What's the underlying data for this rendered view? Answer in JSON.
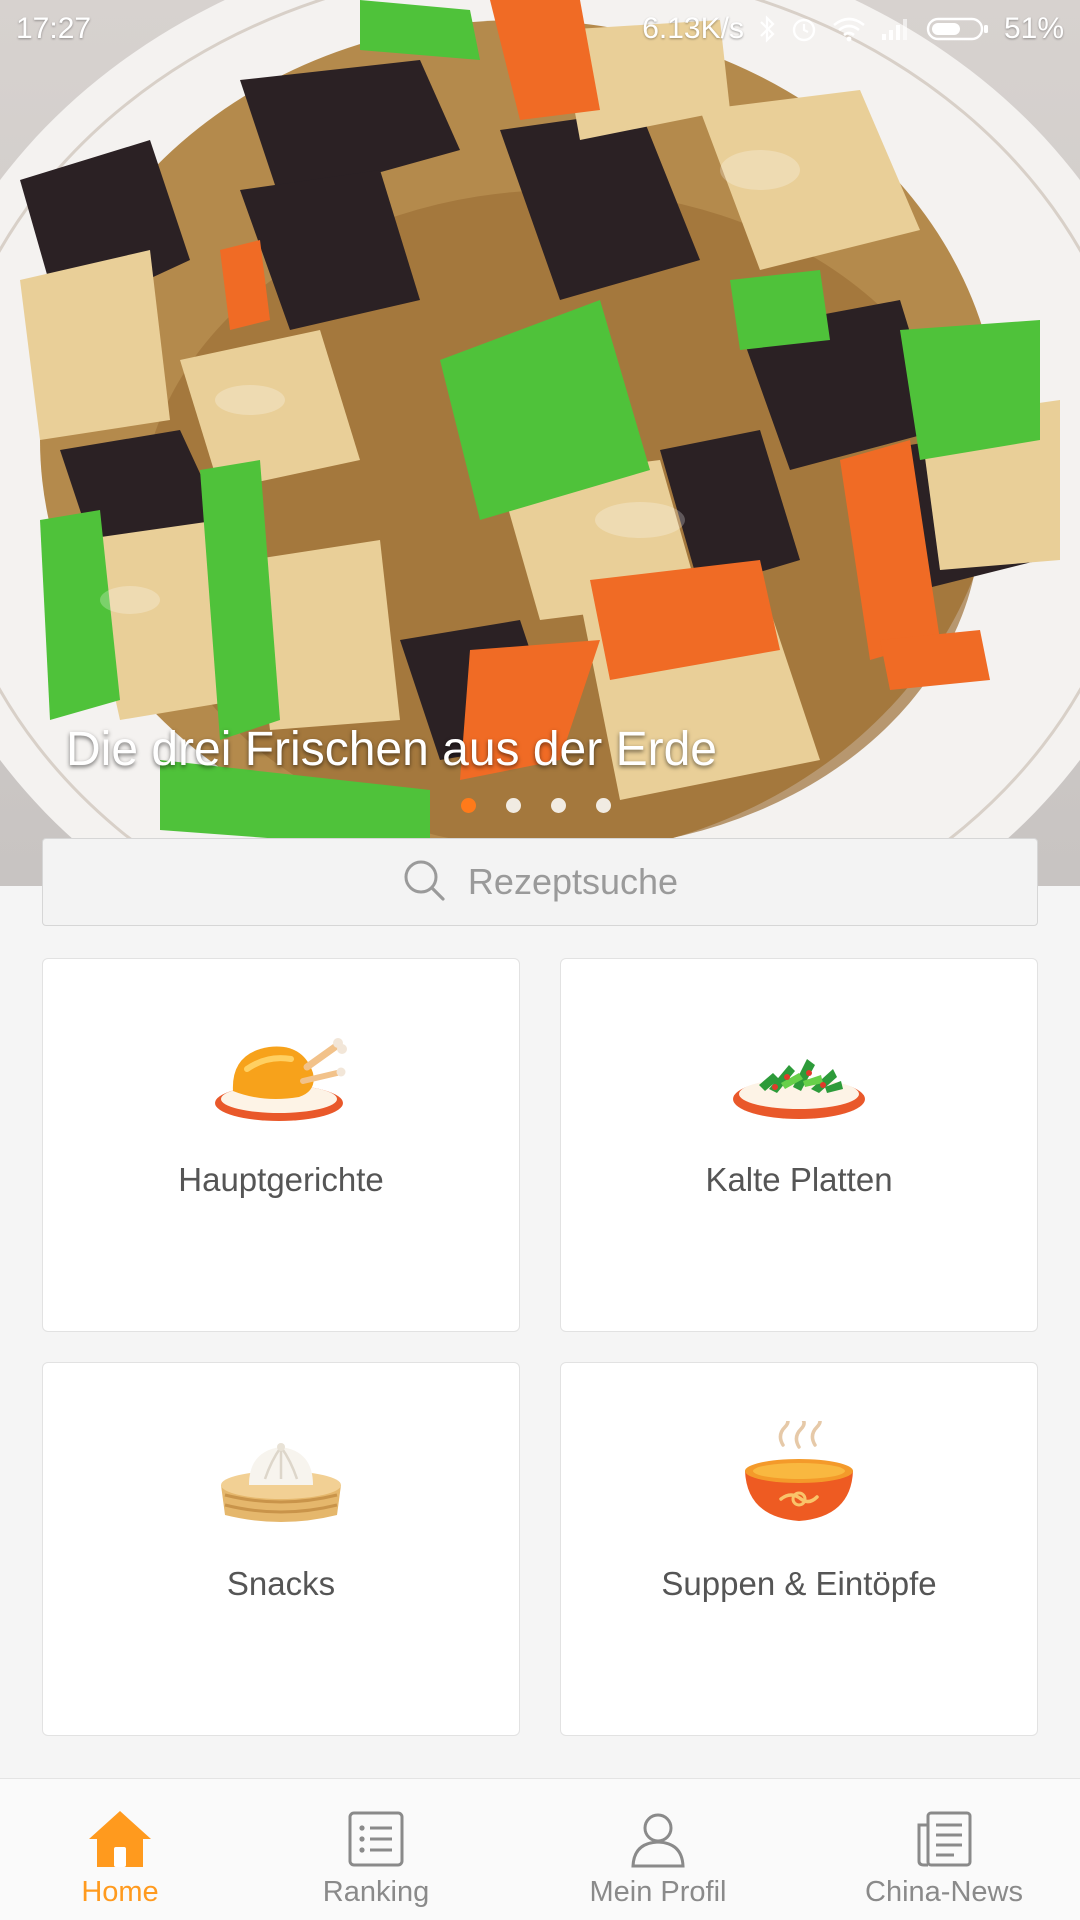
{
  "status_bar": {
    "time": "17:27",
    "network_speed": "6.13K/s",
    "battery": "51%",
    "icons": [
      "bluetooth-icon",
      "alarm-icon",
      "wifi-icon",
      "signal-icon",
      "battery-icon"
    ]
  },
  "banner": {
    "title": "Die drei Frischen aus der Erde",
    "slide_count": 4,
    "active_slide": 1
  },
  "search": {
    "placeholder": "Rezeptsuche",
    "icon": "search-icon"
  },
  "categories": [
    {
      "label": "Hauptgerichte",
      "icon": "roast-chicken-icon"
    },
    {
      "label": "Kalte Platten",
      "icon": "cold-salad-plate-icon"
    },
    {
      "label": "Snacks",
      "icon": "steamed-bun-basket-icon"
    },
    {
      "label": "Suppen & Eintöpfe",
      "icon": "soup-bowl-icon"
    }
  ],
  "nav": {
    "items": [
      {
        "label": "Home",
        "icon": "home-icon",
        "active": true
      },
      {
        "label": "Ranking",
        "icon": "list-icon",
        "active": false
      },
      {
        "label": "Mein Profil",
        "icon": "person-icon",
        "active": false
      },
      {
        "label": "China-News",
        "icon": "news-icon",
        "active": false
      }
    ]
  },
  "colors": {
    "accent": "#ff9a1e",
    "active_dot": "#ff7a1a",
    "background": "#f5f5f5",
    "inactive_text": "#8a8a8a"
  }
}
